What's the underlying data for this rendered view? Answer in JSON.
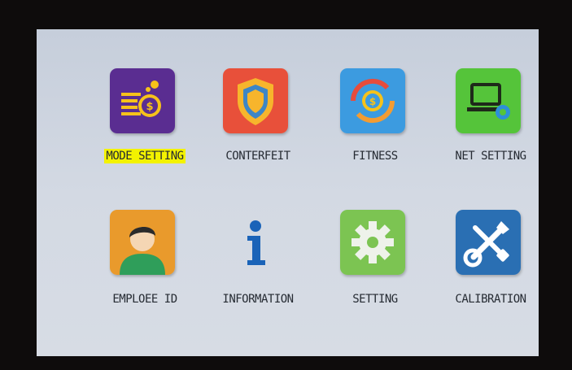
{
  "menu": {
    "items": [
      {
        "label": "MODE SETTING",
        "icon": "mode-setting-icon",
        "color": "#5a2d91",
        "selected": true
      },
      {
        "label": "CONTERFEIT",
        "icon": "shield-icon",
        "color": "#e8503a",
        "selected": false
      },
      {
        "label": "FITNESS",
        "icon": "coin-refresh-icon",
        "color": "#3c9be0",
        "selected": false
      },
      {
        "label": "NET SETTING",
        "icon": "laptop-icon",
        "color": "#55c43a",
        "selected": false
      },
      {
        "label": "EMPLOEE ID",
        "icon": "person-icon",
        "color": "#e99a2c",
        "selected": false
      },
      {
        "label": "INFORMATION",
        "icon": "info-icon",
        "color": "#1a63b8",
        "selected": false
      },
      {
        "label": "SETTING",
        "icon": "gear-icon",
        "color": "#7cc452",
        "selected": false
      },
      {
        "label": "CALIBRATION",
        "icon": "wrench-screwdriver-icon",
        "color": "#2a6fb3",
        "selected": false
      }
    ]
  },
  "colors": {
    "selection_highlight": "#f3f200",
    "screen_background": "#d3d9e3"
  }
}
